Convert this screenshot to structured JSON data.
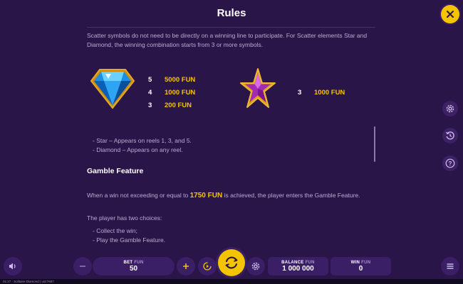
{
  "header": {
    "title": "Rules"
  },
  "content": {
    "intro": "Scatter symbols do not need to be directly on a winning line to participate. For Scatter elements Star and Diamond, the winning combination starts from 3 or more symbols.",
    "diamond_pays": [
      {
        "count": "5",
        "value": "5000 FUN"
      },
      {
        "count": "4",
        "value": "1000 FUN"
      },
      {
        "count": "3",
        "value": "200 FUN"
      }
    ],
    "star_pays": [
      {
        "count": "3",
        "value": "1000 FUN"
      }
    ],
    "bullets": [
      "- Star – Appears on reels 1, 3, and 5.",
      "- Diamond – Appears on any reel."
    ],
    "gamble_title": "Gamble Feature",
    "gamble_text_pre": "When a win not exceeding or equal to",
    "gamble_amount": "1750 FUN",
    "gamble_text_post": "is achieved, the player enters the Gamble Feature.",
    "choices_intro": "The player has two choices:",
    "choices": [
      "- Collect the win;",
      "- Play the Gamble Feature."
    ]
  },
  "bottom": {
    "bet_label": "BET",
    "bet_currency": "FUN",
    "bet_value": "50",
    "balance_label": "BALANCE",
    "balance_currency": "FUN",
    "balance_value": "1 000 000",
    "win_label": "WIN",
    "win_currency": "FUN",
    "win_value": "0"
  },
  "footer": {
    "text": "01:27 · Solitaire Diamond | uid:7687"
  },
  "colors": {
    "background": "#2a1548",
    "accent": "#f5c400",
    "panel": "#3a1f66"
  },
  "icons": [
    "close-icon",
    "settings-icon",
    "history-icon",
    "help-icon",
    "sound-icon",
    "minus-icon",
    "plus-icon",
    "autoplay-icon",
    "spin-icon",
    "gear-icon",
    "menu-icon",
    "diamond-icon",
    "star-icon"
  ]
}
